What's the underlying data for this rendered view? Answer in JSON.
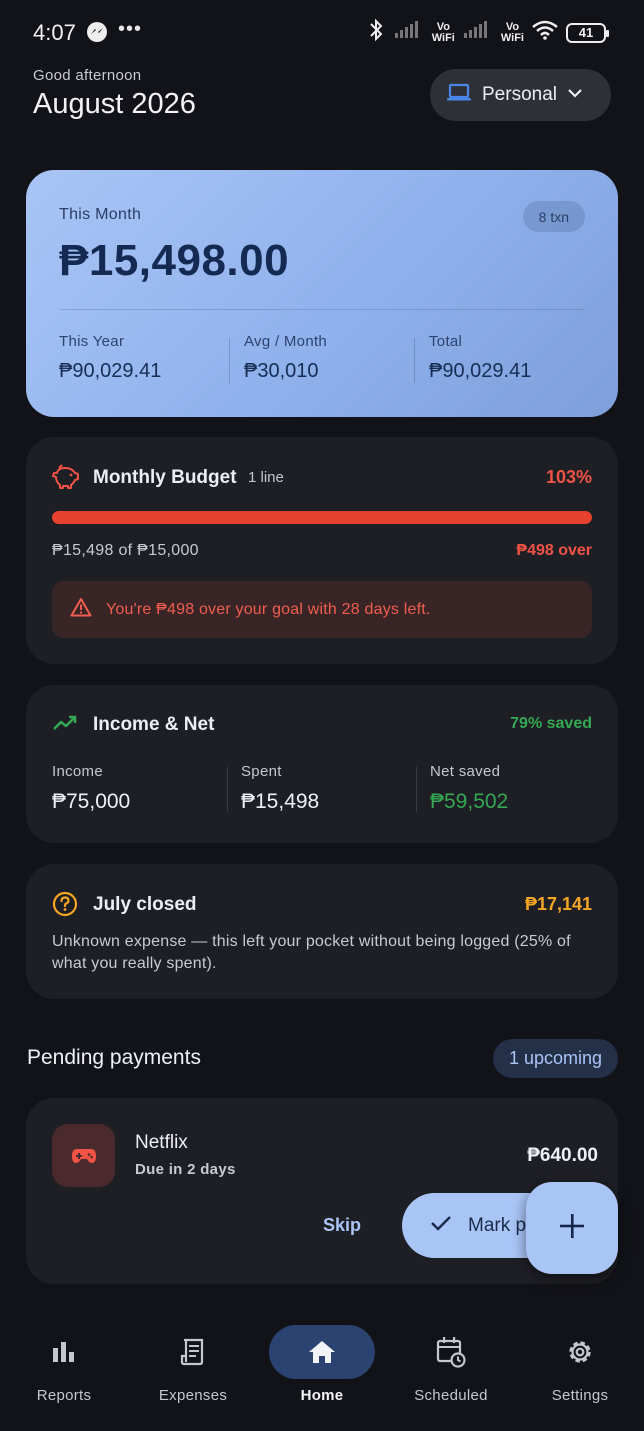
{
  "status_bar": {
    "time": "4:07",
    "dots": "•••",
    "vo1": "Vo\nWiFi",
    "vo2": "Vo\nWiFi",
    "battery": "41",
    "icons": [
      "messenger-icon",
      "bluetooth-icon",
      "signal-icon",
      "wifi-icon",
      "battery-icon"
    ]
  },
  "header": {
    "greeting": "Good afternoon",
    "month": "August 2026",
    "profile": "Personal"
  },
  "summary": {
    "label": "This Month",
    "txn_count": "8 txn",
    "amount": "₱15,498.00",
    "stats": [
      {
        "label": "This Year",
        "value": "₱90,029.41"
      },
      {
        "label": "Avg / Month",
        "value": "₱30,010"
      },
      {
        "label": "Total",
        "value": "₱90,029.41"
      }
    ]
  },
  "budget": {
    "title": "Monthly Budget",
    "lines": "1 line",
    "percent": "103%",
    "progress": 1.0,
    "spent_of": "₱15,498 of ₱15,000",
    "over": "₱498 over",
    "alert": "You're ₱498 over your goal with 28 days left."
  },
  "income": {
    "title": "Income & Net",
    "saved_pct": "79% saved",
    "stats": [
      {
        "label": "Income",
        "value": "₱75,000"
      },
      {
        "label": "Spent",
        "value": "₱15,498"
      },
      {
        "label": "Net saved",
        "value": "₱59,502"
      }
    ]
  },
  "july": {
    "title": "July closed",
    "amount": "₱17,141",
    "description": "Unknown expense — this left your pocket without being logged (25% of what you really spent)."
  },
  "pending": {
    "title": "Pending payments",
    "badge": "1 upcoming",
    "item": {
      "name": "Netflix",
      "due": "Due in 2 days",
      "amount": "₱640.00",
      "skip": "Skip",
      "mark": "Mark paid"
    }
  },
  "nav": [
    {
      "label": "Reports"
    },
    {
      "label": "Expenses"
    },
    {
      "label": "Home"
    },
    {
      "label": "Scheduled"
    },
    {
      "label": "Settings"
    }
  ],
  "colors": {
    "accent": "#a9c5f6",
    "danger": "#ef5345",
    "success": "#34a853",
    "warning": "#f5a623"
  }
}
